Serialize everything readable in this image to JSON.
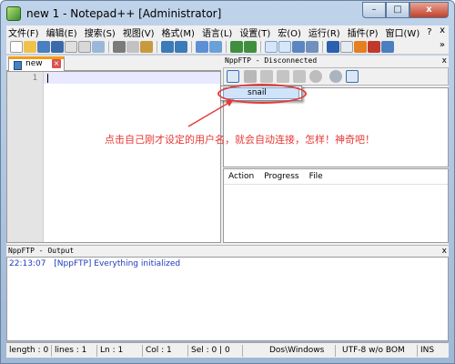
{
  "window": {
    "title": "new  1 - Notepad++ [Administrator]",
    "controls": {
      "minimize": "–",
      "maximize": "□",
      "close": "x"
    }
  },
  "menubar": {
    "items": [
      "文件(F)",
      "编辑(E)",
      "搜索(S)",
      "视图(V)",
      "格式(M)",
      "语言(L)",
      "设置(T)",
      "宏(O)",
      "运行(R)",
      "插件(P)",
      "窗口(W)",
      "?"
    ],
    "close_glyph": "x",
    "overflow": "»"
  },
  "toolbar": {
    "overflow": "»",
    "colors": {
      "folder": "#f1c24a",
      "save": "#4a7fc1",
      "cut": "#7a7a7a",
      "paste": "#c79a3e",
      "undo": "#3d7ab8",
      "find": "#5c8fd6",
      "zoom": "#3f8f3f",
      "macro": "#c0392b",
      "bookmark": "#e67e22"
    }
  },
  "editor": {
    "tab_label": "new",
    "tab_close_glyph": "×",
    "lines": [
      "1"
    ],
    "accent_color": "#f39c12"
  },
  "ftp": {
    "title": "NppFTP - Disconnected",
    "close_glyph": "x",
    "dropdown_item": "snail",
    "queue_columns": [
      "Action",
      "Progress",
      "File"
    ]
  },
  "annotation": {
    "text": "点击自己刚才设定的用户名，就会自动连接，怎样！神奇吧！",
    "color": "#e53935"
  },
  "output": {
    "title": "NppFTP - Output",
    "close_glyph": "x",
    "time": "22:13:07",
    "message": "[NppFTP] Everything initialized",
    "color": "#1d3bbf"
  },
  "statusbar": {
    "length": "length : 0",
    "lines": "lines : 1",
    "ln": "Ln : 1",
    "col": "Col : 1",
    "sel": "Sel : 0 | 0",
    "eol": "Dos\\Windows",
    "encoding": "UTF-8 w/o BOM",
    "mode": "INS"
  }
}
